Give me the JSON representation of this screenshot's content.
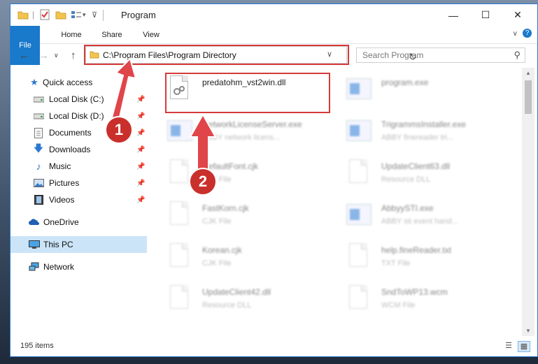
{
  "window": {
    "title": "Program",
    "controls": {
      "minimize": "—",
      "maximize": "☐",
      "close": "✕"
    }
  },
  "ribbon": {
    "tabs": [
      "File",
      "Home",
      "Share",
      "View"
    ]
  },
  "navigation": {
    "address": "C:\\Program Files\\Program Directory",
    "search_placeholder": "Search Program"
  },
  "sidebar": {
    "items": [
      {
        "label": "Quick access",
        "icon": "star-icon"
      },
      {
        "label": "Local Disk (C:)",
        "icon": "drive-icon",
        "pinned": true
      },
      {
        "label": "Local Disk (D:)",
        "icon": "drive-icon",
        "pinned": true
      },
      {
        "label": "Documents",
        "icon": "documents-icon",
        "pinned": true
      },
      {
        "label": "Downloads",
        "icon": "download-icon",
        "pinned": true
      },
      {
        "label": "Music",
        "icon": "music-icon",
        "pinned": true
      },
      {
        "label": "Pictures",
        "icon": "pictures-icon",
        "pinned": true
      },
      {
        "label": "Videos",
        "icon": "videos-icon",
        "pinned": true
      },
      {
        "label": "OneDrive",
        "icon": "cloud-icon"
      },
      {
        "label": "This PC",
        "icon": "computer-icon",
        "selected": true
      },
      {
        "label": "Network",
        "icon": "network-icon"
      }
    ]
  },
  "files": [
    {
      "name": "predatohm_vst2win.dll",
      "desc": "",
      "type": "dll",
      "highlighted": true
    },
    {
      "name": "program.exe",
      "desc": "",
      "type": "exe"
    },
    {
      "name": "NetworkLicenseServer.exe",
      "desc": "ABBY network licens...",
      "type": "exe"
    },
    {
      "name": "TrigrammsInstaller.exe",
      "desc": "ABBY finereader tri...",
      "type": "exe"
    },
    {
      "name": "DefaultFont.cjk",
      "desc": "CJK File",
      "type": "doc"
    },
    {
      "name": "UpdateClient63.dll",
      "desc": "Resource DLL",
      "type": "dll"
    },
    {
      "name": "FastKorn.cjk",
      "desc": "CJK File",
      "type": "doc"
    },
    {
      "name": "AbbyySTI.exe",
      "desc": "ABBY sti event hand...",
      "type": "exe"
    },
    {
      "name": "Korean.cjk",
      "desc": "CJK File",
      "type": "doc"
    },
    {
      "name": "help.fineReader.txt",
      "desc": "TXT File",
      "type": "doc"
    },
    {
      "name": "UpdateClient42.dll",
      "desc": "Resource DLL",
      "type": "dll"
    },
    {
      "name": "SndToWP13.wcm",
      "desc": "WCM File",
      "type": "doc"
    }
  ],
  "status": {
    "item_count": "195 items"
  },
  "annotations": {
    "step1": "1",
    "step2": "2"
  },
  "colors": {
    "accent": "#1979ca",
    "highlight": "#d63a3a",
    "selection": "#cce4f7"
  }
}
